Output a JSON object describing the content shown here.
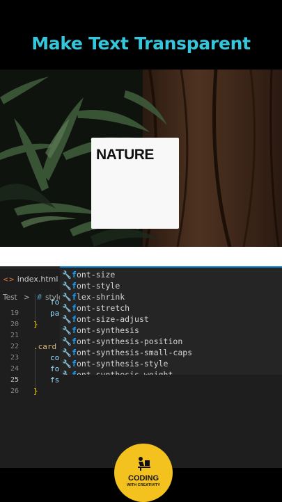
{
  "header": {
    "title": "Make Text Transparent"
  },
  "card": {
    "text": "NATURE"
  },
  "editor": {
    "tab": {
      "filename": "index.html",
      "icon": "html-file-icon"
    },
    "breadcrumb": {
      "folder": "Test",
      "separator": ">",
      "file": "style.cs"
    },
    "line_numbers": [
      "19",
      "20",
      "21",
      "22",
      "23",
      "24",
      "25",
      "26"
    ],
    "active_line": "25",
    "code": {
      "line19": "pa",
      "line20": "}",
      "line22": ".card",
      "line23": "co",
      "line24": "fo",
      "line25": "fs",
      "line26": "}",
      "partial_above": "fo"
    },
    "suggestions": [
      {
        "match": "f",
        "rest": "ont-size"
      },
      {
        "match": "f",
        "rest": "ont-style"
      },
      {
        "match": "f",
        "rest": "lex-shrink"
      },
      {
        "match": "f",
        "rest": "ont-stretch"
      },
      {
        "match": "f",
        "rest": "ont-size-adjust"
      },
      {
        "match": "f",
        "rest": "ont-synthesis"
      },
      {
        "match": "f",
        "rest": "ont-synthesis-position"
      },
      {
        "match": "f",
        "rest": "ont-synthesis-small-caps"
      },
      {
        "match": "f",
        "rest": "ont-synthesis-style"
      },
      {
        "match": "f",
        "rest": "ont-synthesis-weight"
      }
    ],
    "suggestion_icon": "wrench-icon"
  },
  "logo": {
    "main": "CODING",
    "sub": "WITH CREATIVITY",
    "icon": "coder-at-desk-icon",
    "color": "#f4c21f"
  },
  "colors": {
    "title": "#35c6db",
    "editor_bg": "#1e1e1e",
    "accent": "#007acc"
  }
}
